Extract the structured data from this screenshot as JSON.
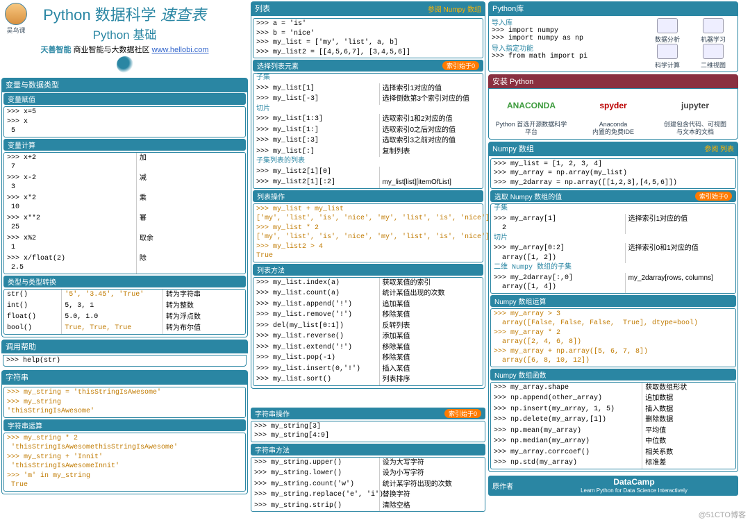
{
  "meta": {
    "avatar_name": "吴鸟课"
  },
  "titleblock": {
    "t1a": "Python 数据科学 ",
    "t1b": "速查表",
    "t2": "Python 基础",
    "tq": "天善智能",
    "txt": " 商业智能与大数据社区 ",
    "url": "www.hellobi.com"
  },
  "c1": {
    "s_vars_title": "变量与数据类型",
    "sub_assign": "变量赋值",
    "assign": ">>> x=5\n>>> x\n 5",
    "sub_calc": "变量计算",
    "calc": [
      [
        ">>> x+2\n 7",
        "加"
      ],
      [
        ">>> x-2\n 3",
        "减"
      ],
      [
        ">>> x*2\n 10",
        "乘"
      ],
      [
        ">>> x**2\n 25",
        "幂"
      ],
      [
        ">>> x%2\n 1",
        "取余"
      ],
      [
        ">>> x/float(2)\n 2.5",
        "除"
      ]
    ],
    "sub_types": "类型与类型转换",
    "types": [
      [
        "str()",
        "'5', '3.45', 'True'",
        "转为字符串"
      ],
      [
        "int()",
        "5, 3, 1",
        "转为整数"
      ],
      [
        "float()",
        "5.0, 1.0",
        "转为浮点数"
      ],
      [
        "bool()",
        "True, True, True",
        "转为布尔值"
      ]
    ],
    "s_help_title": "调用帮助",
    "help": ">>> help(str)",
    "s_str_title": "字符串",
    "str": ">>> my_string = 'thisStringIsAwesome'\n>>> my_string\n'thisStringIsAwesome'",
    "sub_strcalc": "字符串运算",
    "strcalc": ">>> my_string * 2\n 'thisStringIsAwesomethisStringIsAwesome'\n>>> my_string + 'Innit'\n 'thisStringIsAwesomeInnit'\n>>> 'm' in my_string\n True"
  },
  "c2": {
    "s_list_title": "列表",
    "s_list_tag": "参阅 Numpy 数组",
    "list": ">>> a = 'is'\n>>> b = 'nice'\n>>> my_list = ['my', 'list', a, b]\n>>> my_list2 = [[4,5,6,7], [3,4,5,6]]",
    "sub_sel": "选择列表元素",
    "tag0": "索引始于0",
    "lbl_subset": "子集",
    "sel_subset": [
      [
        ">>> my_list[1]",
        "选择索引1对应的值"
      ],
      [
        ">>> my_list[-3]",
        "选择倒数第3个索引对应的值"
      ]
    ],
    "lbl_slice": "切片",
    "sel_slice": [
      [
        ">>> my_list[1:3]",
        "选取索引1和2对应的值"
      ],
      [
        ">>> my_list[1:]",
        "选取索引0之后对应的值"
      ],
      [
        ">>> my_list[:3]",
        "选取索引3之前对应的值"
      ],
      [
        ">>> my_list[:]",
        "复制列表"
      ]
    ],
    "lbl_listoflist": "子集列表的列表",
    "sel_lol": [
      [
        ">>> my_list2[1][0]",
        ""
      ],
      [
        ">>> my_list2[1][:2]",
        "my_list[list][itemOfList]"
      ]
    ],
    "sub_listop": "列表操作",
    "listop": ">>> my_list + my_list\n['my', 'list', 'is', 'nice', 'my', 'list', 'is', 'nice']\n>>> my_list * 2\n['my', 'list', 'is', 'nice', 'my', 'list', 'is', 'nice']\n>>> my_list2 > 4\nTrue",
    "sub_listm": "列表方法",
    "listm": [
      [
        ">>> my_list.index(a)",
        "获取某值的索引"
      ],
      [
        ">>> my_list.count(a)",
        "统计某值出现的次数"
      ],
      [
        ">>> my_list.append('!')",
        "追加某值"
      ],
      [
        ">>> my_list.remove('!')",
        "移除某值"
      ],
      [
        ">>> del(my_list[0:1])",
        "反转列表"
      ],
      [
        ">>> my_list.reverse()",
        "添加某值"
      ],
      [
        ">>> my_list.extend('!')",
        "移除某值"
      ],
      [
        ">>> my_list.pop(-1)",
        "移除某值"
      ],
      [
        ">>> my_list.insert(0,'!')",
        "插入某值"
      ],
      [
        ">>> my_list.sort()",
        "列表排序"
      ]
    ],
    "sub_strop": "字符串操作",
    "strop": ">>> my_string[3]\n>>> my_string[4:9]",
    "sub_strm": "字符串方法",
    "strm": [
      [
        ">>> my_string.upper()",
        "设为大写字符"
      ],
      [
        ">>> my_string.lower()",
        "设为小写字符"
      ],
      [
        ">>> my_string.count('w')",
        "统计某字符出现的次数"
      ],
      [
        ">>> my_string.replace('e', 'i')",
        "替换字符"
      ],
      [
        ">>> my_string.strip()",
        "清除空格"
      ]
    ]
  },
  "c3": {
    "s_lib_title": "Python库",
    "lbl_imp1": "导入库",
    "imp1": ">>> import numpy\n>>> import numpy as np",
    "lbl_imp2": "导入指定功能",
    "imp2": ">>> from math import pi",
    "tools": [
      [
        "数据分析"
      ],
      [
        "机器学习"
      ],
      [
        "科学计算"
      ],
      [
        "二维视图"
      ]
    ],
    "s_install_title": "安装 Python",
    "install": [
      [
        "ANACONDA",
        "Python 首选开源数据科学平台"
      ],
      [
        "spyder",
        "Anaconda\n内置的免费IDE"
      ],
      [
        "jupyter",
        "创建包含代码、可视图\n与文本的文档"
      ]
    ],
    "s_np_title": "Numpy 数组",
    "s_np_tag": "参阅 列表",
    "np": ">>> my_list = [1, 2, 3, 4]\n>>> my_array = np.array(my_list)\n>>> my_2darray = np.array([[1,2,3],[4,5,6]])",
    "sub_npsel": "选取 Numpy 数组的值",
    "lbl_nps": "子集",
    "npsel_s": [
      [
        ">>> my_array[1]\n  2",
        "选择索引1对应的值"
      ]
    ],
    "lbl_npsl": "切片",
    "npsel_sl": [
      [
        ">>> my_array[0:2]\n  array([1, 2])",
        "选择索引0和1对应的值"
      ]
    ],
    "lbl_np2d": "二维 Numpy 数组的子集",
    "npsel_2d": [
      [
        ">>> my_2darray[:,0]\n  array([1, 4])",
        "my_2darray[rows, columns]"
      ]
    ],
    "sub_npop": "Numpy 数组运算",
    "npop": ">>> my_array > 3\n  array([False, False, False,  True], dtype=bool)\n>>> my_array * 2\n  array([2, 4, 6, 8])\n>>> my_array + np.array([5, 6, 7, 8])\n  array([6, 8, 10, 12])",
    "sub_npf": "Numpy 数组函数",
    "npf": [
      [
        ">>> my_array.shape",
        "获取数组形状"
      ],
      [
        ">>> np.append(other_array)",
        "追加数据"
      ],
      [
        ">>> np.insert(my_array, 1, 5)",
        "插入数据"
      ],
      [
        ">>> np.delete(my_array,[1])",
        "删除数据"
      ],
      [
        ">>> np.mean(my_array)",
        "平均值"
      ],
      [
        ">>> np.median(my_array)",
        "中位数"
      ],
      [
        ">>> my_array.corrcoef()",
        "相关系数"
      ],
      [
        ">>> np.std(my_array)",
        "标准差"
      ]
    ],
    "dc_l": "原作者",
    "dc_m": "DataCamp",
    "dc_s": "Learn Python for Data Science Interactively"
  },
  "watermark": "@51CTO博客"
}
